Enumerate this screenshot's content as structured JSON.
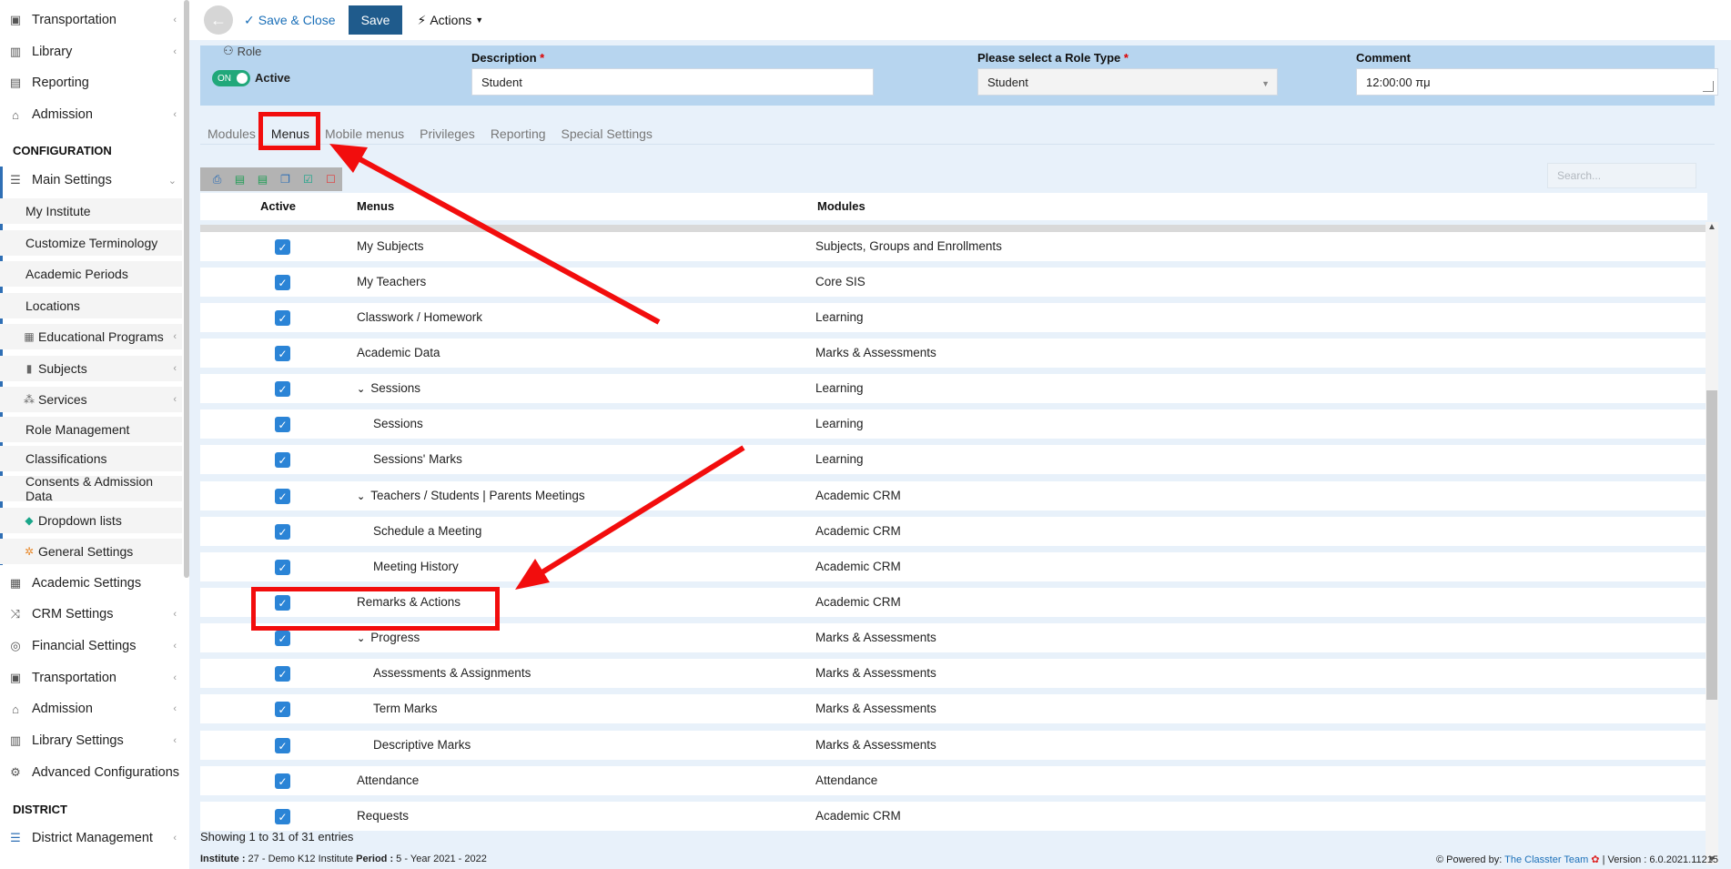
{
  "sidebar": {
    "top_items": [
      {
        "label": "Transportation",
        "icon": "bus-icon"
      },
      {
        "label": "Library",
        "icon": "books-icon"
      },
      {
        "label": "Reporting",
        "icon": "printer-icon"
      },
      {
        "label": "Admission",
        "icon": "building-icon"
      }
    ],
    "config_section": "CONFIGURATION",
    "main_settings": "Main Settings",
    "sub_items": [
      {
        "label": "My Institute",
        "icon": ""
      },
      {
        "label": "Customize Terminology",
        "icon": ""
      },
      {
        "label": "Academic Periods",
        "icon": ""
      },
      {
        "label": "Locations",
        "icon": ""
      },
      {
        "label": "Educational Programs",
        "icon": "table-icon"
      },
      {
        "label": "Subjects",
        "icon": "book-icon"
      },
      {
        "label": "Services",
        "icon": "network-icon"
      },
      {
        "label": "Role Management",
        "icon": ""
      },
      {
        "label": "Classifications",
        "icon": ""
      },
      {
        "label": "Consents & Admission Data",
        "icon": ""
      },
      {
        "label": "Dropdown lists",
        "icon": "layers-icon"
      },
      {
        "label": "General Settings",
        "icon": "gear-icon"
      }
    ],
    "bottom_items": [
      {
        "label": "Academic Settings",
        "icon": "grid-icon"
      },
      {
        "label": "CRM Settings",
        "icon": "shuffle-icon"
      },
      {
        "label": "Financial Settings",
        "icon": "coins-icon"
      },
      {
        "label": "Transportation",
        "icon": "bus-icon"
      },
      {
        "label": "Admission",
        "icon": "building-icon"
      },
      {
        "label": "Library Settings",
        "icon": "books-icon"
      },
      {
        "label": "Advanced Configurations",
        "icon": "gears-icon"
      }
    ],
    "district_section": "DISTRICT",
    "district_item": "District Management"
  },
  "toolbar": {
    "save_close": "Save & Close",
    "save": "Save",
    "actions": "Actions"
  },
  "form": {
    "role_label": "Role",
    "toggle": "ON",
    "active": "Active",
    "description_label": "Description",
    "description_value": "Student",
    "role_type_label": "Please select a Role Type",
    "role_type_value": "Student",
    "comment_label": "Comment",
    "comment_value": "12:00:00 πμ",
    "required_mark": "*"
  },
  "tabs": [
    "Modules",
    "Menus",
    "Mobile menus",
    "Privileges",
    "Reporting",
    "Special Settings"
  ],
  "search_placeholder": "Search...",
  "table": {
    "headers": {
      "active": "Active",
      "menus": "Menus",
      "modules": "Modules"
    },
    "rows": [
      {
        "menu": "My Subjects",
        "module": "Subjects, Groups and Enrollments",
        "level": 0,
        "expand": false
      },
      {
        "menu": "My Teachers",
        "module": "Core SIS",
        "level": 0,
        "expand": false
      },
      {
        "menu": "Classwork / Homework",
        "module": "Learning",
        "level": 0,
        "expand": false
      },
      {
        "menu": "Academic Data",
        "module": "Marks & Assessments",
        "level": 0,
        "expand": false
      },
      {
        "menu": "Sessions",
        "module": "Learning",
        "level": 0,
        "expand": true
      },
      {
        "menu": "Sessions",
        "module": "Learning",
        "level": 1,
        "expand": false
      },
      {
        "menu": "Sessions' Marks",
        "module": "Learning",
        "level": 1,
        "expand": false
      },
      {
        "menu": "Teachers / Students | Parents Meetings",
        "module": "Academic CRM",
        "level": 0,
        "expand": true
      },
      {
        "menu": "Schedule a Meeting",
        "module": "Academic CRM",
        "level": 1,
        "expand": false
      },
      {
        "menu": "Meeting History",
        "module": "Academic CRM",
        "level": 1,
        "expand": false
      },
      {
        "menu": "Remarks & Actions",
        "module": "Academic CRM",
        "level": 0,
        "expand": false
      },
      {
        "menu": "Progress",
        "module": "Marks & Assessments",
        "level": 0,
        "expand": true
      },
      {
        "menu": "Assessments & Assignments",
        "module": "Marks & Assessments",
        "level": 1,
        "expand": false
      },
      {
        "menu": "Term Marks",
        "module": "Marks & Assessments",
        "level": 1,
        "expand": false
      },
      {
        "menu": "Descriptive Marks",
        "module": "Marks & Assessments",
        "level": 1,
        "expand": false
      },
      {
        "menu": "Attendance",
        "module": "Attendance",
        "level": 0,
        "expand": false
      },
      {
        "menu": "Requests",
        "module": "Academic CRM",
        "level": 0,
        "expand": false
      }
    ]
  },
  "showing": "Showing 1 to 31 of 31 entries",
  "footer": {
    "institute_label": "Institute :",
    "institute_value": " 27 - Demo K12 Institute ",
    "period_label": "Period :",
    "period_value": " 5 - Year 2021 - 2022",
    "powered_by": "Powered by:",
    "team": "The Classter Team",
    "version": "| Version : 6.0.2021.11215"
  },
  "colors": {
    "accent": "#1f5b8c",
    "annotation": "#f20d0d",
    "toggle": "#21a87a",
    "checkbox": "#2b84d6"
  }
}
